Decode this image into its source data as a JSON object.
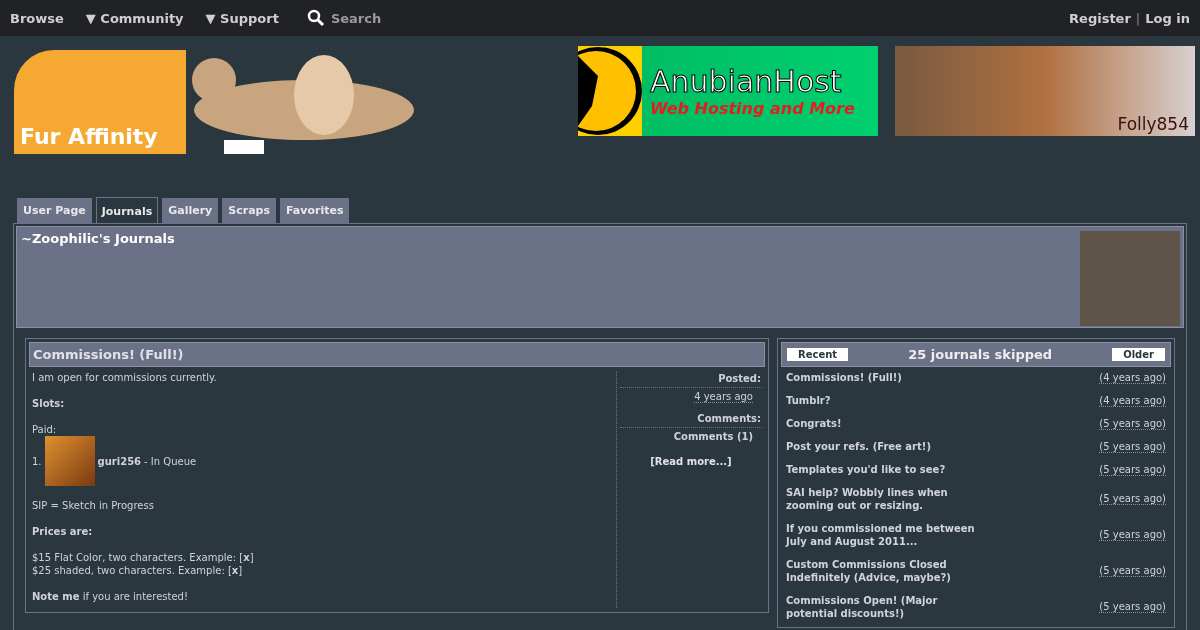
{
  "nav": {
    "left": [
      "Browse",
      "▼ Community",
      "▼ Support"
    ],
    "search": {
      "placeholder": "Search"
    },
    "right": [
      "Register",
      "Log in"
    ],
    "separator": "|"
  },
  "header": {
    "logo_text": "Fur Affinity",
    "banners": [
      {
        "kind": "host",
        "title": "AnubianHost",
        "subtitle": "Web Hosting and More"
      },
      {
        "kind": "art",
        "title": "Folly854"
      }
    ]
  },
  "tabs": [
    {
      "label": "User Page",
      "selected": false
    },
    {
      "label": "Journals",
      "selected": true
    },
    {
      "label": "Gallery",
      "selected": false
    },
    {
      "label": "Scraps",
      "selected": false
    },
    {
      "label": "Favorites",
      "selected": false
    }
  ],
  "profile": {
    "title": "~Zoophilic's Journals"
  },
  "journal": {
    "title": "Commissions! (Full!)",
    "body": [
      {
        "kind": "text",
        "text": "I am open for commissions currently."
      },
      {
        "kind": "text",
        "text": "**Slots:**"
      },
      {
        "kind": "queue",
        "label": "Paid:",
        "number": "1.",
        "user": "guri256",
        "status": "- In Queue"
      },
      {
        "kind": "text",
        "text": "SIP = Sketch in Progress"
      },
      {
        "kind": "text",
        "text": "**Prices are:**"
      },
      {
        "kind": "lines",
        "lines": [
          "$15 Flat Color, two characters. Example: [**x**]",
          "$25 shaded, two characters. Example: [**x**]"
        ]
      },
      {
        "kind": "text",
        "text": "**Note me** if you are interested!"
      }
    ],
    "posted_label": "Posted:",
    "posted": "4 years ago",
    "comments_label": "Comments:",
    "comments": "Comments (1)",
    "read_more": "[Read more...]"
  },
  "list": {
    "recent": "Recent",
    "skipped": "25 journals skipped",
    "older": "Older",
    "items": [
      {
        "title": "Commissions! (Full!)",
        "age": "(4 years ago)"
      },
      {
        "title": "Tumblr?",
        "age": "(4 years ago)"
      },
      {
        "title": "Congrats!",
        "age": "(5 years ago)"
      },
      {
        "title": "Post your refs. (Free art!)",
        "age": "(5 years ago)"
      },
      {
        "title": "Templates you'd like to see?",
        "age": "(5 years ago)"
      },
      {
        "title": "SAI help? Wobbly lines when zooming out or resizing.",
        "age": "(5 years ago)"
      },
      {
        "title": "If you commissioned me between July and August 2011...",
        "age": "(5 years ago)"
      },
      {
        "title": "Custom Commissions Closed Indefinitely (Advice, maybe?)",
        "age": "(5 years ago)"
      },
      {
        "title": "Commissions Open! (Major potential discounts!)",
        "age": "(5 years ago)"
      }
    ]
  }
}
